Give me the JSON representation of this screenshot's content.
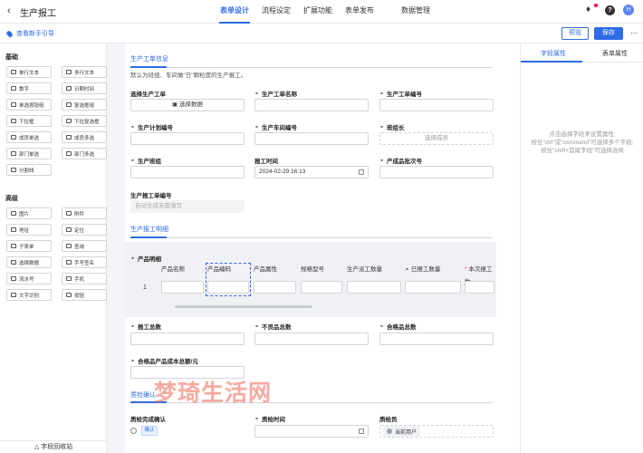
{
  "header": {
    "back_icon": "chevron-left-icon",
    "app_title": "生产报工",
    "tabs": [
      {
        "label": "表单设计",
        "active": true
      },
      {
        "label": "流程设定"
      },
      {
        "label": "扩展功能"
      },
      {
        "label": "表单发布"
      },
      {
        "label": "数据管理"
      }
    ],
    "help_label": "?",
    "avatar_label": "H"
  },
  "subbar": {
    "guide_label": "查看新手引导",
    "preview_label": "预览",
    "save_label": "保存"
  },
  "components": {
    "basic_title": "基础",
    "basic": [
      "单行文本",
      "多行文本",
      "数字",
      "日期时间",
      "单选按钮组",
      "复选框组",
      "下拉框",
      "下拉复选框",
      "成员单选",
      "成员多选",
      "部门单选",
      "部门多选",
      "分割线"
    ],
    "advanced_title": "高级",
    "advanced": [
      "图片",
      "附件",
      "地址",
      "定位",
      "子表单",
      "查询",
      "选择数据",
      "手写签名",
      "流水号",
      "手机",
      "文字识别",
      "按钮"
    ],
    "recycle_label": "字段回收站"
  },
  "form": {
    "section1_title": "生产工单信息",
    "section1_note": "默认为班组、车间做\"日\"颗粒度的生产报工。",
    "f_order": "选择生产工单",
    "select_data_btn": "选择数据",
    "f_order_name": "生产工单名称",
    "f_order_no": "生产工单编号",
    "f_plan_no": "生产计划编号",
    "f_workshop": "生产车间编号",
    "f_leader": "班组长",
    "select_member": "选择成员",
    "f_team": "生产班组",
    "f_report_time": "报工时间",
    "report_time_value": "2024-02-29 16:13",
    "f_batch": "产成品批次号",
    "f_report_no": "生产报工单编号",
    "report_no_placeholder": "自动生成无需填写",
    "section2_title": "生产报工明细",
    "subtable_title": "产品明细",
    "subtable_cols": [
      "产品名称",
      "产品编码",
      "产品属性",
      "规格型号",
      "生产派工数量",
      "已报工数量",
      "本次报工数"
    ],
    "row_index": "1",
    "f_total": "报工总数",
    "f_defect": "不良品总数",
    "f_qualified": "合格品总数",
    "f_cost": "合格品产品成本总额/元",
    "section3_title": "质检确认",
    "f_qc_confirm": "质检完成确认",
    "confirm_option": "确认",
    "f_qc_time": "质检时间",
    "f_qc_person": "质检员",
    "current_user": "当前用户"
  },
  "right": {
    "tab_field": "字段属性",
    "tab_form": "表单属性",
    "hint_lines": [
      "点击选择字段来设置属性;",
      "按住\"ctrl\"或\"command\"可选择多个字段;",
      "按住\"shift+首尾字段\"可选择连续"
    ]
  },
  "watermark": "梦琦生活网",
  "colors": {
    "accent": "#2e6be6",
    "watermark": "#ec6450"
  }
}
